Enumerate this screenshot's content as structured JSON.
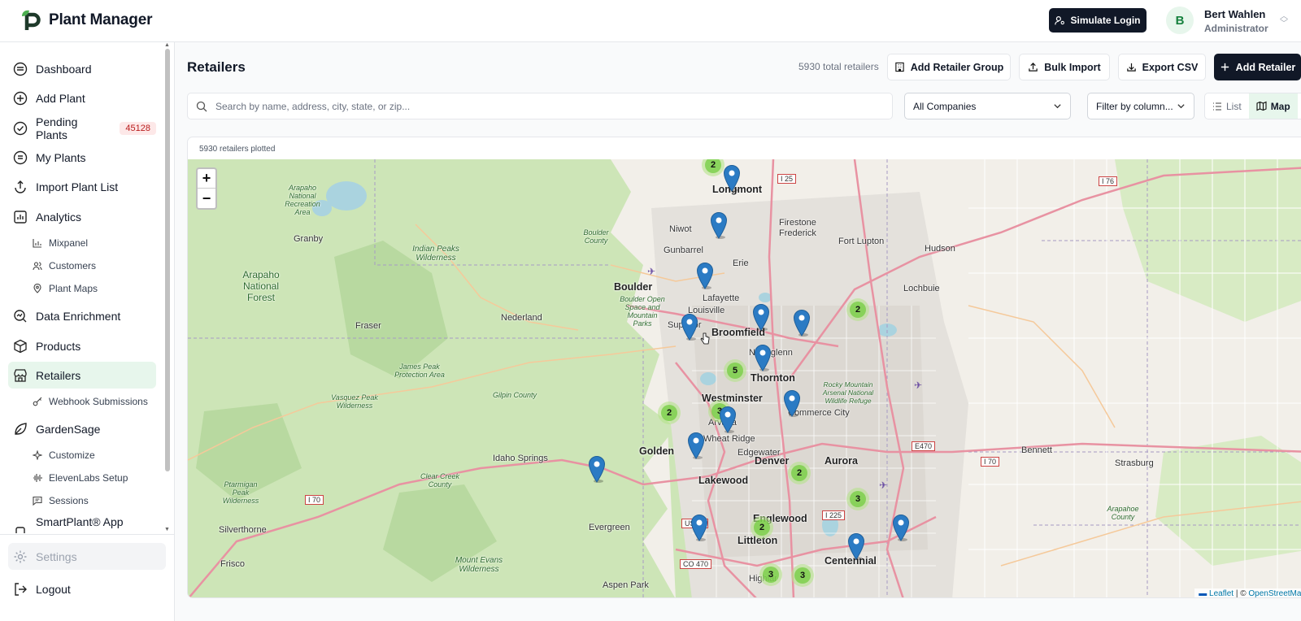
{
  "app": {
    "name": "Plant Manager"
  },
  "header": {
    "simulate_login": "Simulate Login",
    "user": {
      "initial": "B",
      "name": "Bert Wahlen",
      "role": "Administrator"
    }
  },
  "sidebar": {
    "items": [
      {
        "label": "Dashboard",
        "icon": "dashboard-icon"
      },
      {
        "label": "Add Plant",
        "icon": "plus-circle-icon"
      },
      {
        "label": "Pending Plants",
        "icon": "check-circle-icon",
        "badge": "45128"
      },
      {
        "label": "My Plants",
        "icon": "list-icon"
      },
      {
        "label": "Import Plant List",
        "icon": "upload-icon"
      },
      {
        "label": "Analytics",
        "icon": "bar-chart-icon"
      },
      {
        "label": "Data Enrichment",
        "icon": "search-data-icon"
      },
      {
        "label": "Products",
        "icon": "box-icon"
      },
      {
        "label": "Retailers",
        "icon": "store-icon"
      },
      {
        "label": "GardenSage",
        "icon": "leaf-icon"
      },
      {
        "label": "SmartPlant® App",
        "icon": "phone-icon"
      }
    ],
    "analytics_sub": [
      "Mixpanel",
      "Customers",
      "Plant Maps"
    ],
    "retailers_sub": [
      "Webhook Submissions"
    ],
    "gardensage_sub": [
      "Customize",
      "ElevenLabs Setup",
      "Sessions"
    ],
    "settings": "Settings",
    "logout": "Logout"
  },
  "main": {
    "title": "Retailers",
    "total": "5930 total retailers",
    "buttons": {
      "add_group": "Add Retailer Group",
      "bulk_import": "Bulk Import",
      "export_csv": "Export CSV",
      "add_retailer": "Add Retailer"
    },
    "search_placeholder": "Search by name, address, city, state, or zip...",
    "company_filter": "All Companies",
    "column_filter": "Filter by column...",
    "view_list": "List",
    "view_map": "Map",
    "plotted": "5930 retailers plotted"
  },
  "map": {
    "attribution_leaflet": "Leaflet",
    "attribution_sep": " | © ",
    "attribution_osm": "OpenStreetMap",
    "places": {
      "longmont": "Longmont",
      "niwot": "Niwot",
      "gunbarrel": "Gunbarrel",
      "firestone": "Firestone",
      "frederick": "Frederick",
      "fort_lupton": "Fort Lupton",
      "hudson": "Hudson",
      "erie": "Erie",
      "boulder": "Boulder",
      "lafayette": "Lafayette",
      "louisville": "Louisville",
      "lochbuie": "Lochbuie",
      "superior": "Superior",
      "broomfield": "Broomfield",
      "northglenn": "Northglenn",
      "thornton": "Thornton",
      "westminster": "Westminster",
      "arvada": "Arvada",
      "commerce_city": "Commerce City",
      "golden": "Golden",
      "wheat_ridge": "Wheat Ridge",
      "edgewater": "Edgewater",
      "denver": "Denver",
      "aurora": "Aurora",
      "bennett": "Bennett",
      "strasburg": "Strasburg",
      "lakewood": "Lakewood",
      "englewood": "Englewood",
      "littleton": "Littleton",
      "centennial": "Centennial",
      "evergreen": "Evergreen",
      "idaho_springs": "Idaho Springs",
      "nederland": "Nederland",
      "fraser": "Fraser",
      "granby": "Granby",
      "silverthorne": "Silverthorne",
      "frisco": "Frisco",
      "aspen_park": "Aspen Park",
      "highlands_ranch": "Highlands Ranch",
      "arapaho_nf": "Arapaho National Forest",
      "indian_peaks": "Indian Peaks Wilderness",
      "arapaho_nra": "Arapaho National Recreation Area",
      "boulder_county": "Boulder County",
      "boulder_space": "Boulder Open Space and Mountain Parks",
      "james_peak": "James Peak Protection Area",
      "vasquez": "Vasquez Peak Wilderness",
      "gilpin": "Gilpin County",
      "clear_creek": "Clear Creek County",
      "ptarmigan": "Ptarmigan Peak Wilderness",
      "mount_evans": "Mount Evans Wilderness",
      "rocky_mtn_arsenal": "Rocky Mountain Arsenal National Wildlife Refuge",
      "arapahoe_county": "Arapahoe County"
    },
    "shields": {
      "i25": "I 25",
      "i76": "I 76",
      "e470": "E470",
      "i70e": "I 70",
      "i70w": "I 70",
      "i225": "I 225",
      "us285": "US 28",
      "co470": "CO 470"
    },
    "clusters": [
      2,
      2,
      5,
      3,
      2,
      2,
      3,
      2,
      3,
      3
    ],
    "pin_count": 15,
    "colors": {
      "forest": "#cde5b7",
      "pin": "#2b7bc4",
      "cluster_inner": "#6ecc39",
      "accent_green": "#e7f6ec"
    }
  }
}
